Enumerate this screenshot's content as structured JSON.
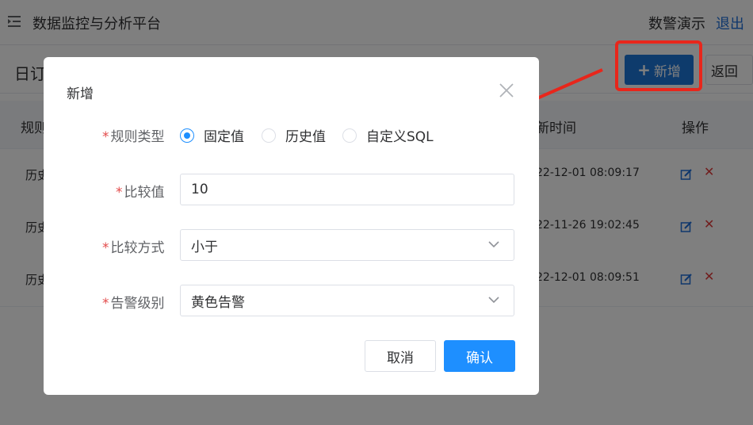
{
  "header": {
    "app_title": "数据监控与分析平台",
    "user": "数警演示",
    "logout": "退出"
  },
  "subbar": {
    "page_label": "日订",
    "add_label": "新增",
    "back_label": "返回"
  },
  "table": {
    "col_rule": "规则",
    "col_time": "新时间",
    "col_ops": "操作",
    "rows": [
      {
        "type": "历史",
        "time": "22-12-01 08:09:17"
      },
      {
        "type": "历史",
        "time": "22-11-26 19:02:45"
      },
      {
        "type": "历史",
        "time": "22-12-01 08:09:51"
      }
    ]
  },
  "dialog": {
    "title": "新增",
    "rule_type_label": "规则类型",
    "rule_type_options": [
      "固定值",
      "历史值",
      "自定义SQL"
    ],
    "rule_type_selected": "固定值",
    "compare_value_label": "比较值",
    "compare_value": "10",
    "compare_mode_label": "比较方式",
    "compare_mode": "小于",
    "alert_level_label": "告警级别",
    "alert_level": "黄色告警",
    "cancel": "取消",
    "confirm": "确认"
  },
  "colors": {
    "primary": "#1e8fff",
    "annotation": "#e8261b",
    "required": "#e34b4b"
  },
  "icons": [
    "menu-fold-icon",
    "plus-icon",
    "close-icon",
    "chevron-down-icon",
    "edit-icon",
    "delete-icon"
  ]
}
